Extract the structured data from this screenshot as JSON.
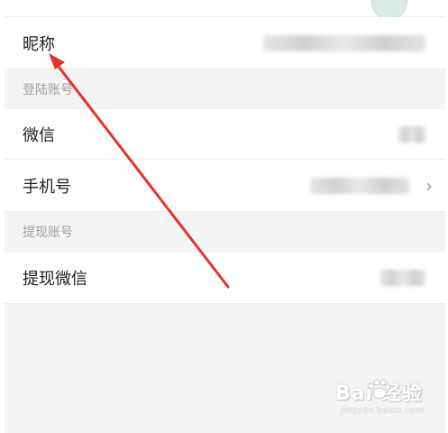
{
  "profile": {
    "nickname_label": "昵称"
  },
  "sections": {
    "login_accounts": "登陆账号",
    "withdraw_accounts": "提现账号"
  },
  "rows": {
    "wechat_label": "微信",
    "phone_label": "手机号",
    "withdraw_wechat_label": "提现微信"
  },
  "icons": {
    "chevron": "chevron-right-icon"
  },
  "chevron_glyph": "›",
  "watermark": {
    "main": "Bai  经验",
    "sub": "jingyan.baidu.com"
  },
  "colors": {
    "arrow": "#e8312a",
    "background": "#f4f4f4",
    "row_background": "#ffffff"
  }
}
